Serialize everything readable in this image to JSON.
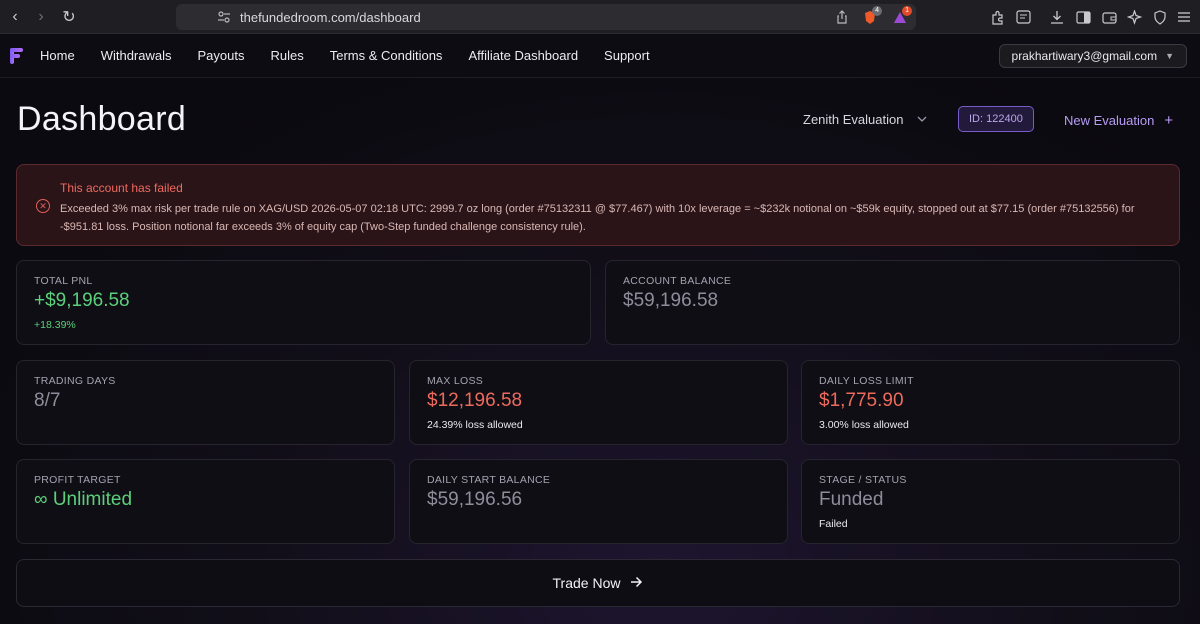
{
  "browser": {
    "url": "thefundedroom.com/dashboard",
    "shields_badge": "4",
    "rewards_badge": "1"
  },
  "nav": {
    "links": [
      "Home",
      "Withdrawals",
      "Payouts",
      "Rules",
      "Terms & Conditions",
      "Affiliate Dashboard",
      "Support"
    ],
    "user_email": "prakhartiwary3@gmail.com"
  },
  "header": {
    "title": "Dashboard",
    "evaluation_select": "Zenith Evaluation",
    "account_id": "ID: 122400",
    "new_evaluation": "New Evaluation"
  },
  "alert": {
    "title": "This account has failed",
    "message": "Exceeded 3% max risk per trade rule on XAG/USD 2026-05-07 02:18 UTC: 2999.7 oz long (order #75132311 @ $77.467) with 10x leverage = ~$232k notional on ~$59k equity, stopped out at $77.15 (order #75132556) for -$951.81 loss. Position notional far exceeds 3% of equity cap (Two-Step funded challenge consistency rule)."
  },
  "stats": {
    "total_pnl": {
      "label": "TOTAL PNL",
      "value": "+$9,196.58",
      "sub": "+18.39%"
    },
    "account_balance": {
      "label": "ACCOUNT BALANCE",
      "value": "$59,196.58"
    },
    "trading_days": {
      "label": "TRADING DAYS",
      "value": "8/7"
    },
    "max_loss": {
      "label": "MAX LOSS",
      "value": "$12,196.58",
      "sub": "24.39% loss allowed"
    },
    "daily_loss_limit": {
      "label": "DAILY LOSS LIMIT",
      "value": "$1,775.90",
      "sub": "3.00% loss allowed"
    },
    "profit_target": {
      "label": "PROFIT TARGET",
      "value": "∞ Unlimited"
    },
    "daily_start_balance": {
      "label": "DAILY START BALANCE",
      "value": "$59,196.56"
    },
    "stage_status": {
      "label": "STAGE / STATUS",
      "value": "Funded",
      "sub": "Failed"
    }
  },
  "actions": {
    "trade_now": "Trade Now"
  },
  "colors": {
    "accent": "#b79cf5",
    "positive": "#5ccf7a",
    "negative": "#ee6a5b",
    "alert_bg": "#2a1418"
  }
}
